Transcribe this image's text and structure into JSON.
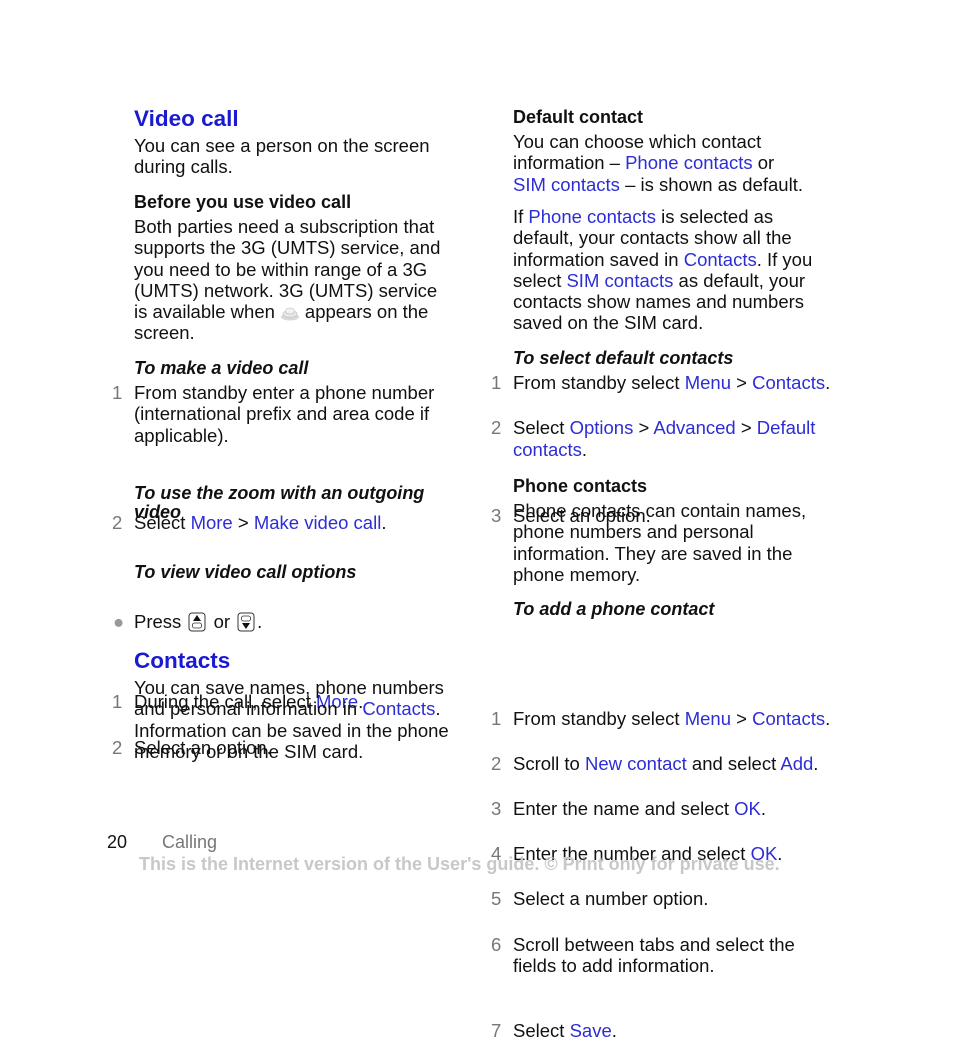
{
  "left": {
    "video_call": {
      "title": "Video call",
      "intro": "You can see a person on the screen during calls.",
      "before": {
        "heading": "Before you use video call",
        "text_a": "Both parties need a subscription that supports the 3G (UMTS) service, and you need to be within range of a 3G (UMTS) network. 3G (UMTS) service is available when",
        "icon": "3g-network-icon",
        "text_b": "appears on the screen."
      },
      "make_call": {
        "heading": "To make a video call",
        "steps": [
          {
            "num": "1",
            "text": "From standby enter a phone number (international prefix and area code if applicable)."
          },
          {
            "num": "2",
            "pre": "Select ",
            "link1": "More",
            "sep": " > ",
            "link2": "Make video call",
            "post": "."
          }
        ]
      },
      "zoom": {
        "heading": "To use the zoom with an outgoing video",
        "pre": "Press",
        "icon_up": "navigation-key-up-icon",
        "mid": "or",
        "icon_down": "navigation-key-down-icon",
        "post": "."
      },
      "options": {
        "heading": "To view video call options",
        "steps": [
          {
            "num": "1",
            "pre": "During the call, select ",
            "link1": "More",
            "post": "."
          },
          {
            "num": "2",
            "text": "Select an option."
          }
        ]
      }
    },
    "contacts": {
      "title": "Contacts",
      "text_a": "You can save names, phone numbers and personal information in ",
      "link": "Contacts",
      "text_b": ". Information can be saved in the phone memory or on the SIM card."
    }
  },
  "right": {
    "default_contact": {
      "heading": "Default contact",
      "p1": {
        "a": "You can choose which contact information – ",
        "l1": "Phone contacts",
        "b": " or ",
        "l2": "SIM contacts",
        "c": " – is shown as default."
      },
      "p2": {
        "a": "If ",
        "l1": "Phone contacts",
        "b": " is selected as default, your contacts show all the information saved in ",
        "l2": "Contacts",
        "c": ". If you select ",
        "l3": "SIM contacts",
        "d": " as default, your contacts show names and numbers saved on the SIM card."
      }
    },
    "select_default": {
      "heading": "To select default contacts",
      "steps": [
        {
          "num": "1",
          "pre": "From standby select ",
          "l1": "Menu",
          "sep": " > ",
          "l2": "Contacts",
          "post": "."
        },
        {
          "num": "2",
          "pre": "Select ",
          "l1": "Options",
          "sep1": " > ",
          "l2": "Advanced",
          "sep2": " > ",
          "l3": "Default contacts",
          "post": "."
        },
        {
          "num": "3",
          "text": "Select an option."
        }
      ]
    },
    "phone_contacts": {
      "heading": "Phone contacts",
      "text": "Phone contacts can contain names, phone numbers and personal information. They are saved in the phone memory."
    },
    "add_contact": {
      "heading": "To add a phone contact",
      "steps": [
        {
          "num": "1",
          "pre": "From standby select ",
          "l1": "Menu",
          "sep": " > ",
          "l2": "Contacts",
          "post": "."
        },
        {
          "num": "2",
          "pre": "Scroll to ",
          "l1": "New contact",
          "mid": " and select ",
          "l2": "Add",
          "post": "."
        },
        {
          "num": "3",
          "pre": "Enter the name and select ",
          "l1": "OK",
          "post": "."
        },
        {
          "num": "4",
          "pre": "Enter the number and select ",
          "l1": "OK",
          "post": "."
        },
        {
          "num": "5",
          "text": "Select a number option."
        },
        {
          "num": "6",
          "text": "Scroll between tabs and select the fields to add information."
        },
        {
          "num": "7",
          "pre": "Select ",
          "l1": "Save",
          "post": "."
        }
      ]
    }
  },
  "footer": {
    "page_number": "20",
    "section": "Calling",
    "notice": "This is the Internet version of the User's guide. © Print only for private use."
  },
  "colors": {
    "heading": "#1a1ad2",
    "link": "#2d2dd6",
    "step_number": "#777777",
    "notice": "#c8c8c8"
  }
}
